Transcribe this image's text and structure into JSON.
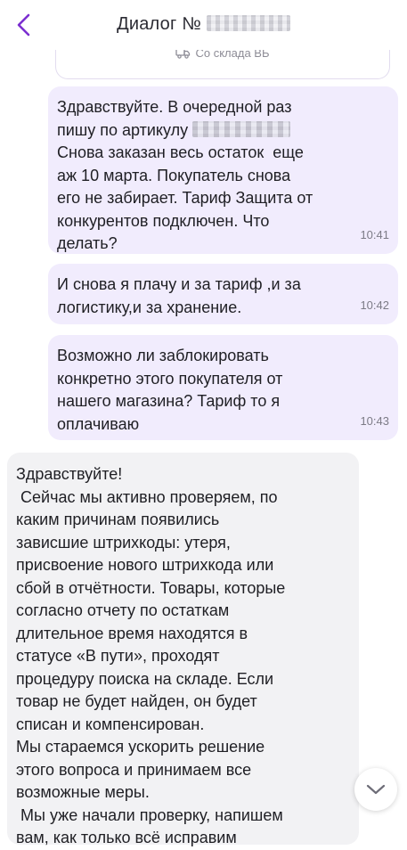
{
  "header": {
    "title": "Диалог №",
    "back_icon": "chevron-left-icon",
    "accent_color": "#7b2fd0"
  },
  "order_card": {
    "source_label": "Со склада ВБ",
    "icon": "truck-icon"
  },
  "messages": [
    {
      "direction": "outgoing",
      "text_before": "Здравствуйте. В очередной раз\nпишу по артикулу ",
      "text_after": "\nСнова заказан весь остаток  еще\nаж 10 марта. Покупатель снова\nего не забирает. Тариф Защита от\nконкурентов подключен. Что\nделать?",
      "time": "10:41"
    },
    {
      "direction": "outgoing",
      "text": "И снова я плачу и за тариф ,и за\nлогистику,и за хранение.",
      "time": "10:42"
    },
    {
      "direction": "outgoing",
      "text": "Возможно ли заблокировать\nконкретно этого покупателя от\nнашего магазина? Тариф то я\nоплачиваю",
      "time": "10:43"
    },
    {
      "direction": "incoming",
      "text": "Здравствуйте!\n Сейчас мы активно проверяем, по\nкаким причинам появились\nзависшие штрихкоды: утеря,\nприсвоение нового штрихкода или\nсбой в отчётности. Товары, которые\nсогласно отчету по остаткам\nдлительное время находятся в\nстатусе «В пути», проходят\nпроцедуру поиска на складе. Если\nтовар не будет найден, он будет\nсписан и компенсирован.\nМы стараемся ускорить решение\nэтого вопроса и принимаем все\nвозможные меры.\n Мы уже начали проверку, напишем\nвам, как только всё исправим"
    }
  ],
  "scroll_button": {
    "icon": "chevron-down-icon"
  },
  "colors": {
    "outgoing_bubble": "#f1ecfd",
    "incoming_bubble": "#f2f2f4",
    "time_text": "#7c7b86"
  }
}
